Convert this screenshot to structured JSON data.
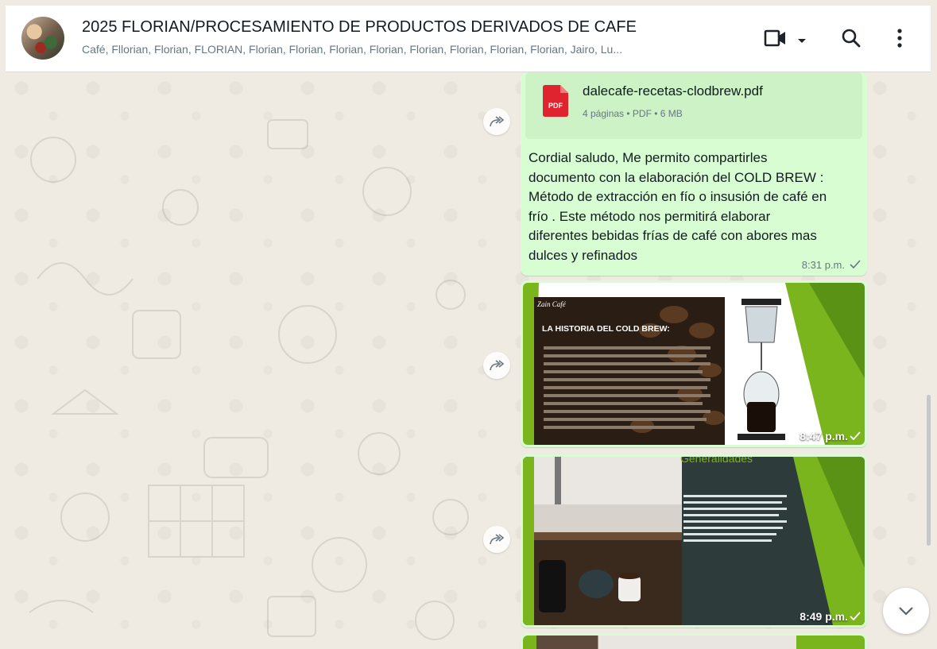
{
  "header": {
    "title": "2025  FLORIAN/PROCESAMIENTO DE PRODUCTOS DERIVADOS DE CAFE",
    "participants": "Café, Fllorian, Florian, FLORIAN, Florian, Florian, Florian, Florian, Florian, Florian, Florian, Florian, Jairo, Lu...",
    "icons": [
      "video-call-icon",
      "chevron-down-icon",
      "search-icon",
      "more-options-icon"
    ]
  },
  "messages": [
    {
      "type": "document",
      "file_name": "dalecafe-recetas-clodbrew.pdf",
      "file_meta": "4 páginas • PDF • 6 MB",
      "file_icon_label": "PDF",
      "text_lines": [
        "Cordial saludo,  Me permito compartirles",
        "documento con la elaboración del COLD BREW :",
        "Método de extracción en fío o insusión de café en",
        "frío .   Este método nos permitirá elaborar",
        "diferentes bebidas frías de café con abores mas",
        "dulces y refinados"
      ],
      "time": "8:31 p.m.",
      "status": "sent-check"
    },
    {
      "type": "image",
      "slide_title": "LA HISTORIA DEL COLD BREW:",
      "logo": "Zain Café",
      "time": "8:47 p.m.",
      "status": "sent-check"
    },
    {
      "type": "image",
      "slide_title": "Generalidades",
      "time": "8:49 p.m.",
      "status": "sent-check"
    },
    {
      "type": "image",
      "time": ""
    }
  ],
  "colors": {
    "chat_bg": "#efeae2",
    "outgoing_bubble": "#d9fdd3",
    "pdf_red": "#e0242f",
    "slide_green": "#7ab51d"
  }
}
